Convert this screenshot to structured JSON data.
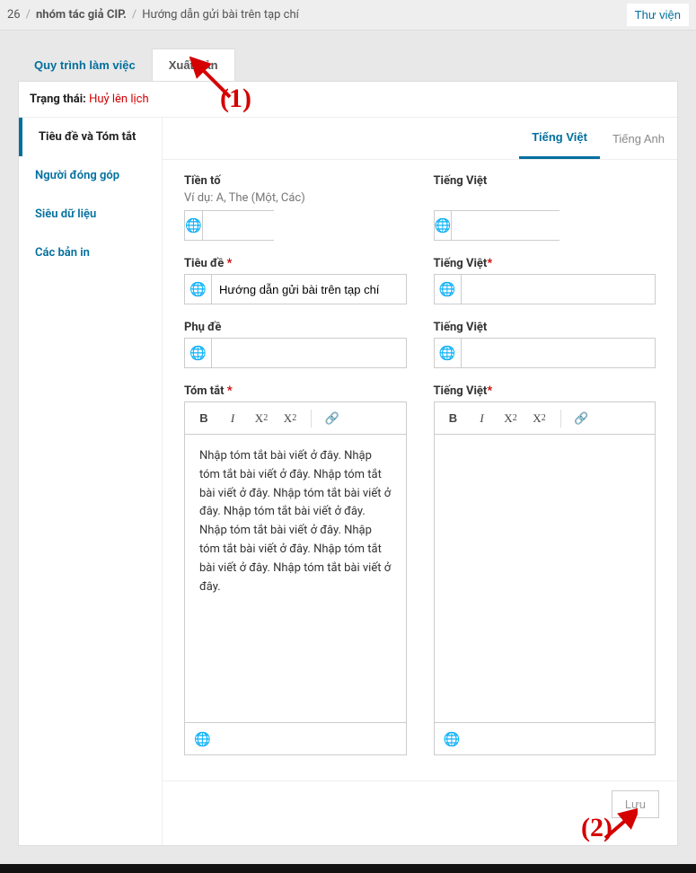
{
  "breadcrumb": {
    "id": "26",
    "group": "nhóm tác giả CIP.",
    "title": "Hướng dẫn gửi bài trên tạp chí"
  },
  "library_btn": "Thư viện",
  "tabs": {
    "workflow": "Quy trình làm việc",
    "publish": "Xuất bản"
  },
  "status": {
    "label": "Trạng thái:",
    "value": "Huỷ lên lịch"
  },
  "sidenav": {
    "title_abstract": "Tiêu đề và Tóm tắt",
    "contributors": "Người đóng góp",
    "metadata": "Siêu dữ liệu",
    "galleys": "Các bản in"
  },
  "langtabs": {
    "vi": "Tiếng Việt",
    "en": "Tiếng Anh"
  },
  "form": {
    "prefix_label": "Tiền tố",
    "prefix_hint": "Ví dụ: A, The (Một, Các)",
    "lang_label": "Tiếng Việt",
    "title_label": "Tiêu đề",
    "title_value": "Hướng dẫn gửi bài trên tạp chí",
    "subtitle_label": "Phụ đề",
    "abstract_label": "Tóm tắt",
    "abstract_value": "Nhập tóm tắt bài viết ở đây. Nhập tóm tắt bài viết ở đây. Nhập tóm tắt bài viết ở đây. Nhập tóm tắt bài viết ở đây. Nhập tóm tắt bài viết ở đây. Nhập tóm tắt bài viết ở đây. Nhập tóm tắt bài viết ở đây. Nhập tóm tắt bài viết ở đây. Nhập tóm tắt bài viết ở đây."
  },
  "save_btn": "Lưu",
  "annotation": {
    "a1": "(1)",
    "a2": "(2)"
  },
  "toolbar": {
    "bold": "B",
    "italic": "I",
    "sup": "X",
    "sub": "X"
  }
}
